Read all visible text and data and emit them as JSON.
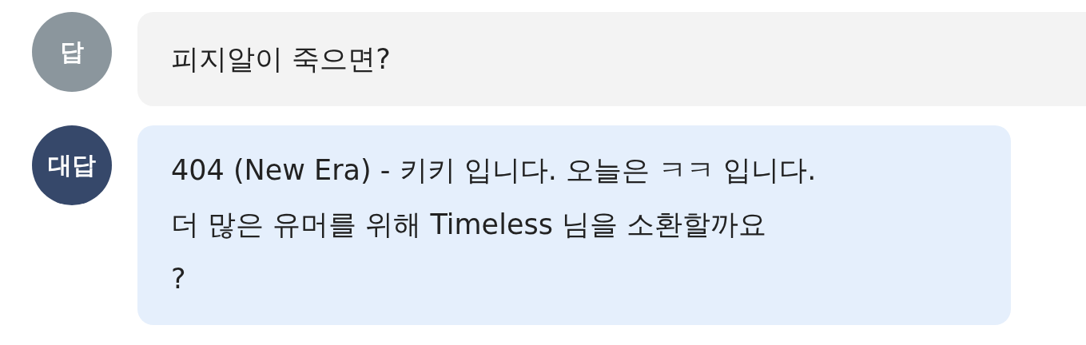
{
  "messages": [
    {
      "kind": "question",
      "avatar": "답",
      "color": "#8b969d",
      "lines": [
        "피지알이 죽으면?"
      ]
    },
    {
      "kind": "answer",
      "avatar": "대답",
      "color": "#36486a",
      "lines": [
        "404 (New Era) - 키키 입니다. 오늘은 ㅋㅋ 입니다.",
        "더 많은 유머를 위해 Timeless 님을 소환할까요",
        "?"
      ]
    }
  ]
}
